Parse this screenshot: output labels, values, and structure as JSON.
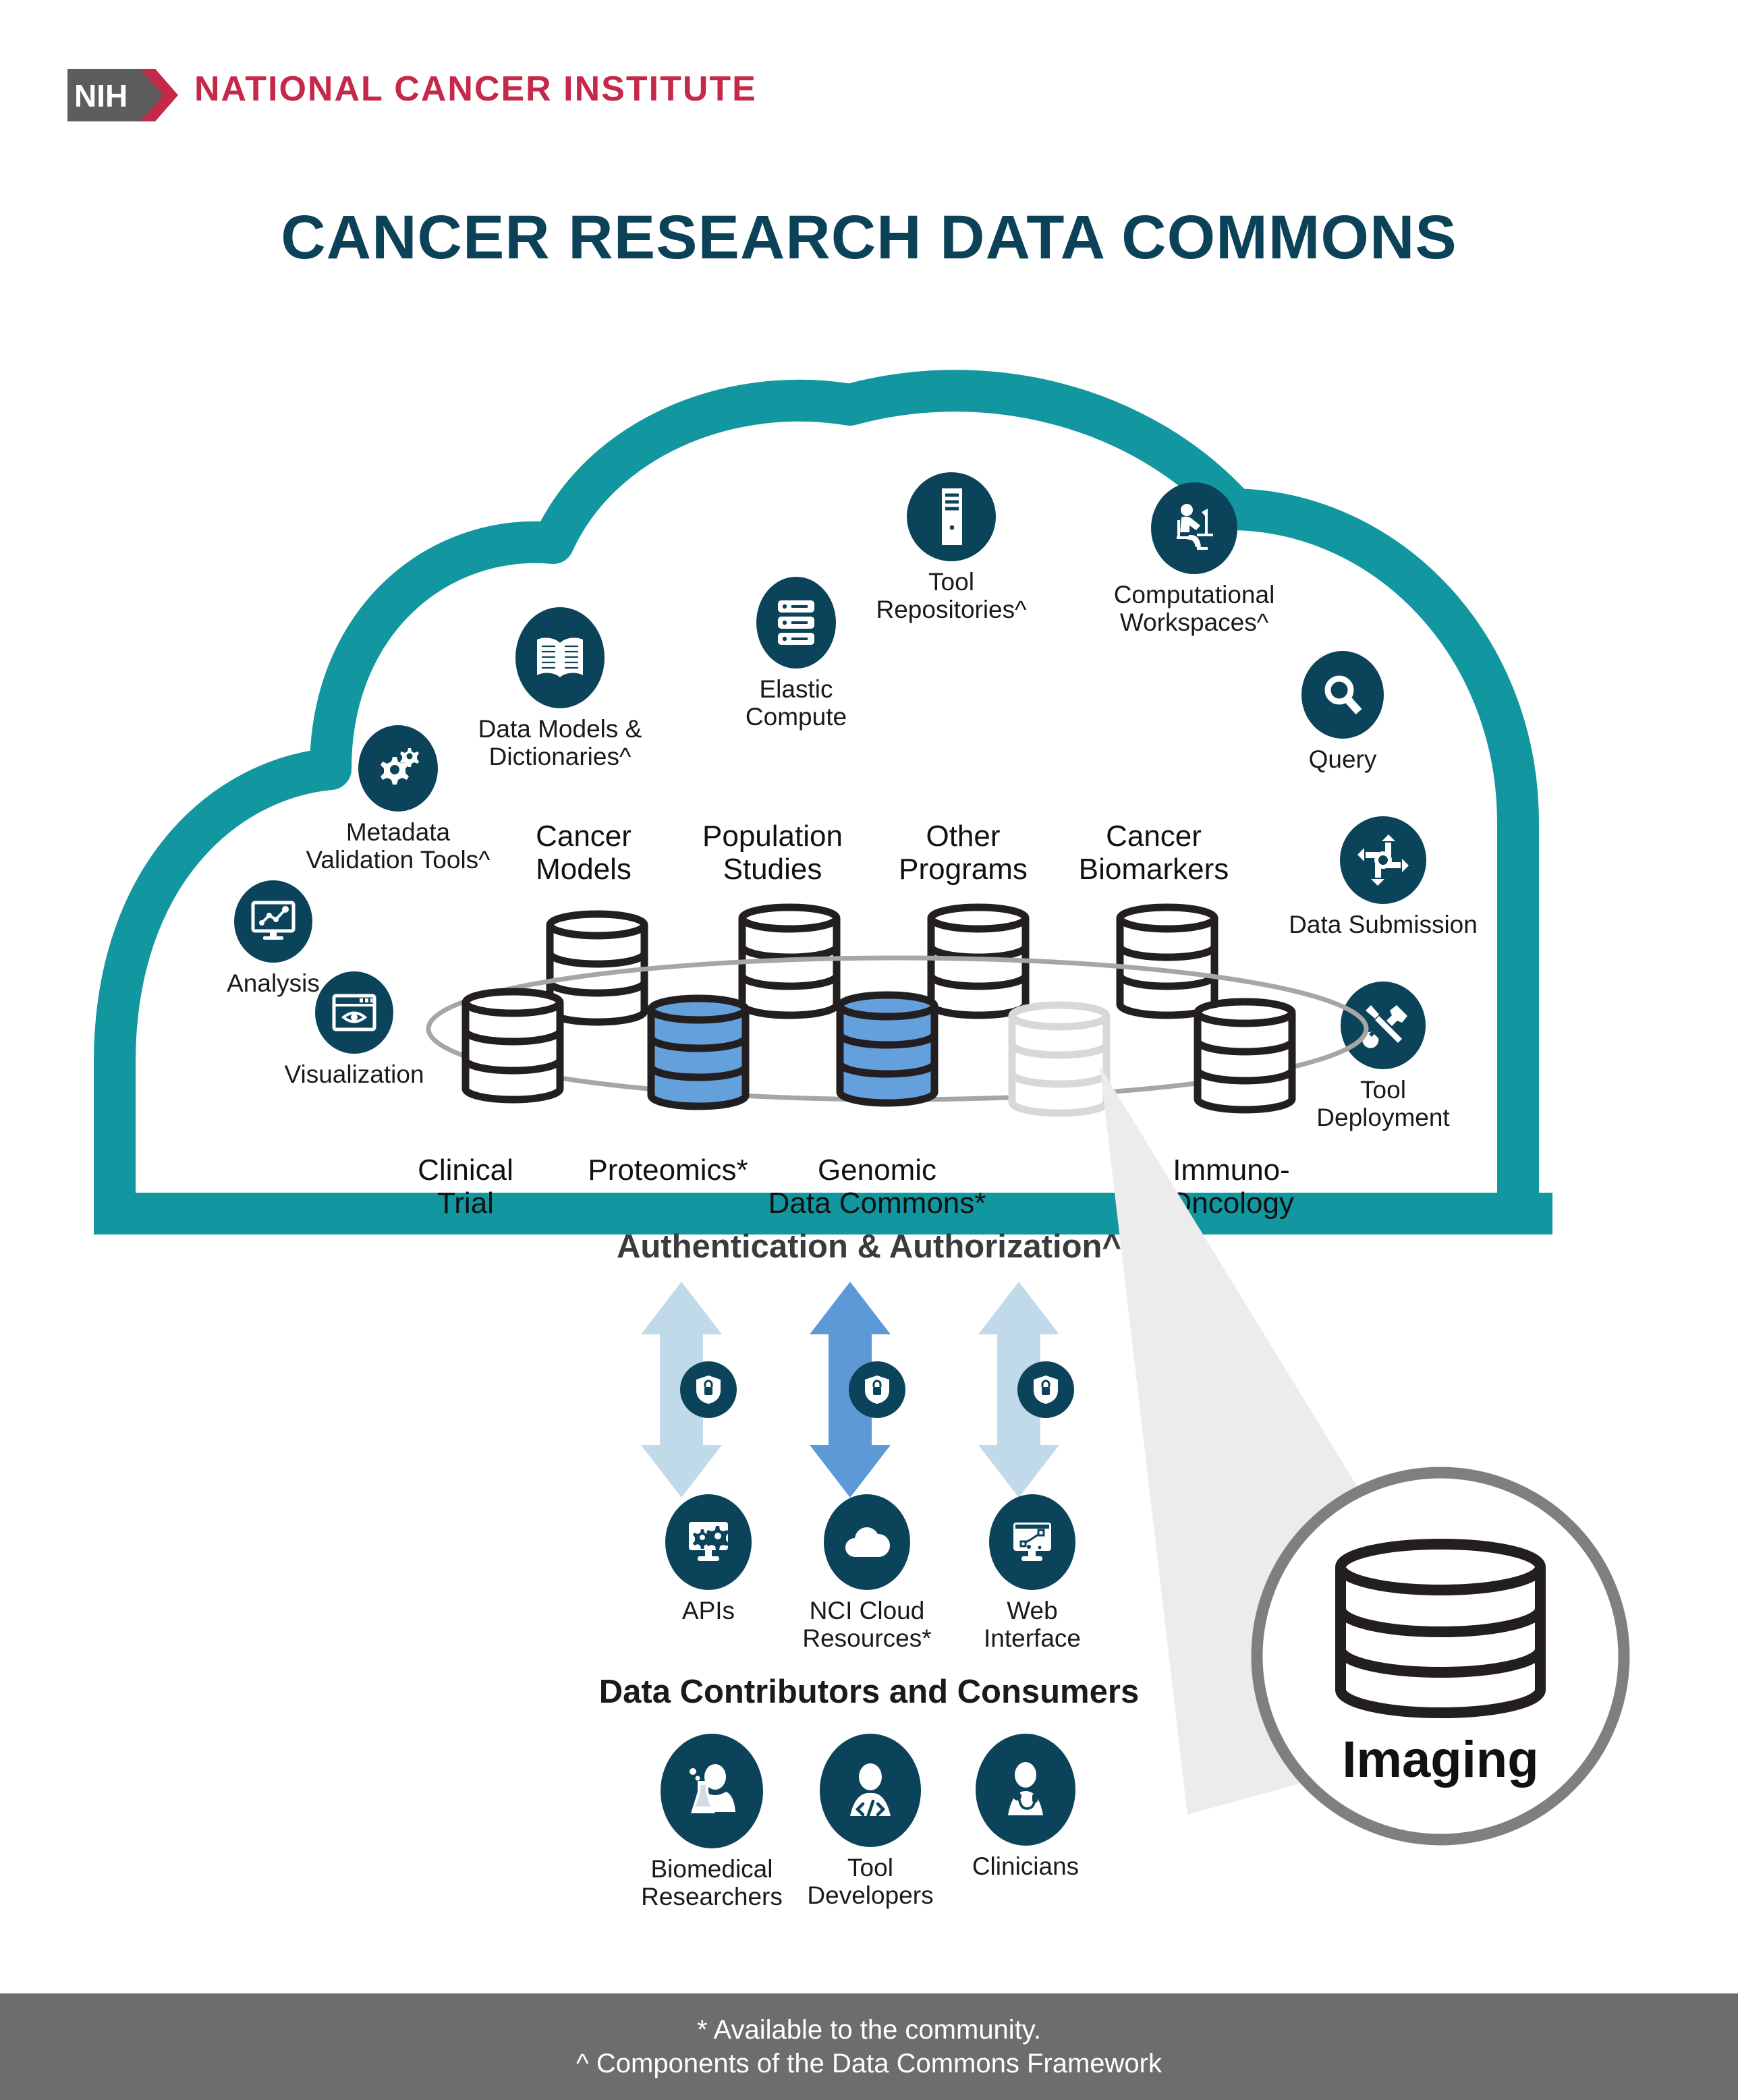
{
  "header": {
    "logo_alt": "NIH",
    "wordmark": "NATIONAL CANCER INSTITUTE",
    "nih_text": "NIH",
    "logo_gray": "#5d5d5d",
    "logo_red": "#c5294a"
  },
  "page_title": "CANCER RESEARCH DATA COMMONS",
  "colors": {
    "teal": "#1296a0",
    "navy": "#0b435a",
    "title_navy": "#0c4258",
    "blue_cylinder": "#64a0dc",
    "arrow_light": "#c1daea",
    "arrow_dark": "#5d99d6",
    "footer_gray": "#6d6d6d",
    "magnifier_gray": "#7f7f7f",
    "cone_gray": "#e9e9e9"
  },
  "cloud_services": [
    {
      "id": "data-models",
      "label": "Data Models &\nDictionaries^",
      "icon": "open-book-icon"
    },
    {
      "id": "elastic-compute",
      "label": "Elastic\nCompute",
      "icon": "server-stack-icon"
    },
    {
      "id": "tool-repositories",
      "label": "Tool\nRepositories^",
      "icon": "server-tower-icon"
    },
    {
      "id": "computational-workspaces",
      "label": "Computational\nWorkspaces^",
      "icon": "person-at-desk-icon"
    },
    {
      "id": "query",
      "label": "Query",
      "icon": "magnifying-glass-icon"
    },
    {
      "id": "data-submission",
      "label": "Data Submission",
      "icon": "refresh-cycle-icon"
    },
    {
      "id": "tool-deployment",
      "label": "Tool\nDeployment",
      "icon": "wrench-screwdriver-icon"
    },
    {
      "id": "metadata-validation",
      "label": "Metadata\nValidation Tools^",
      "icon": "gears-icon"
    },
    {
      "id": "analysis",
      "label": "Analysis",
      "icon": "monitor-chart-icon"
    },
    {
      "id": "visualization",
      "label": "Visualization",
      "icon": "window-eye-icon"
    }
  ],
  "data_nodes_top": [
    {
      "id": "cancer-models",
      "label": "Cancer\nModels"
    },
    {
      "id": "population-studies",
      "label": "Population\nStudies"
    },
    {
      "id": "other-programs",
      "label": "Other\nPrograms"
    },
    {
      "id": "cancer-biomarkers",
      "label": "Cancer\nBiomarkers"
    }
  ],
  "data_nodes_bottom": [
    {
      "id": "clinical-trial",
      "label": "Clinical\nTrial",
      "style": "white"
    },
    {
      "id": "proteomics",
      "label": "Proteomics*",
      "style": "blue"
    },
    {
      "id": "genomic-data-commons",
      "label": "Genomic\nData Commons*",
      "style": "blue"
    },
    {
      "id": "imaging-faded",
      "label": "",
      "style": "faded"
    },
    {
      "id": "immuno-oncology",
      "label": "Immuno-\nOncology",
      "style": "white"
    }
  ],
  "auth": {
    "title": "Authentication & Authorization^",
    "lock_icon": "shield-lock-icon",
    "arrows": [
      "light",
      "dark",
      "light"
    ]
  },
  "access_points": [
    {
      "id": "apis",
      "label": "APIs",
      "icon": "monitor-gears-icon"
    },
    {
      "id": "nci-cloud-resources",
      "label": "NCI Cloud\nResources*",
      "icon": "cloud-icon"
    },
    {
      "id": "web-interface",
      "label": "Web\nInterface",
      "icon": "monitor-network-icon"
    }
  ],
  "contributors": {
    "title": "Data Contributors and Consumers",
    "personas": [
      {
        "id": "biomedical-researchers",
        "label": "Biomedical\nResearchers",
        "icon": "scientist-icon"
      },
      {
        "id": "tool-developers",
        "label": "Tool\nDevelopers",
        "icon": "developer-code-icon"
      },
      {
        "id": "clinicians",
        "label": "Clinicians",
        "icon": "clinician-stethoscope-icon"
      }
    ]
  },
  "magnifier": {
    "label": "Imaging",
    "icon": "database-cylinder-icon"
  },
  "footer": {
    "line1": "* Available to the community.",
    "line2": "^ Components of the Data Commons Framework"
  }
}
